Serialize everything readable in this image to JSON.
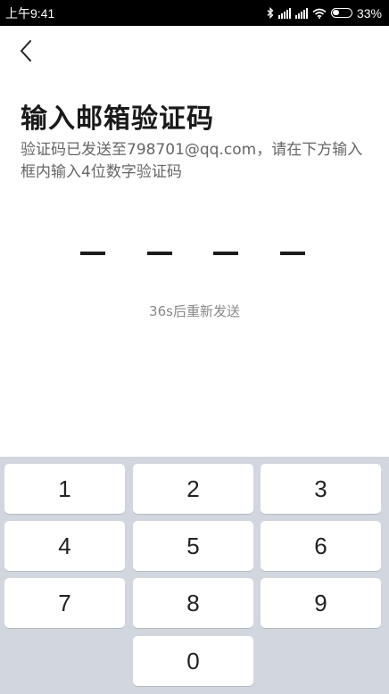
{
  "status_bar": {
    "time": "上午9:41",
    "battery": "33%"
  },
  "page": {
    "title": "输入邮箱验证码",
    "description": "验证码已发送至798701@qq.com，请在下方输入框内输入4位数字验证码",
    "code_slots": [
      "",
      "",
      "",
      ""
    ],
    "resend": "36s后重新发送"
  },
  "keypad": {
    "keys": [
      "1",
      "2",
      "3",
      "4",
      "5",
      "6",
      "7",
      "8",
      "9",
      "0"
    ]
  }
}
